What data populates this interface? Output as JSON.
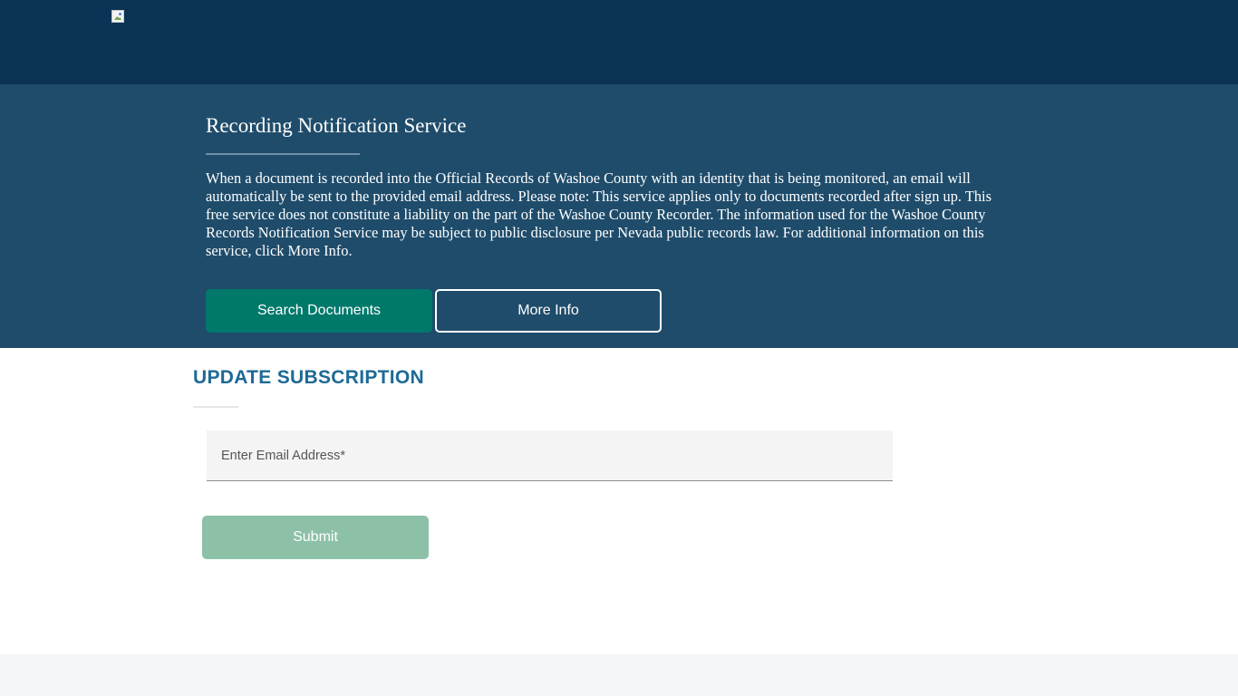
{
  "header": {
    "logo_icon": "broken-image-icon",
    "background": "#0b3355"
  },
  "hero": {
    "title": "Recording Notification Service",
    "description": "When a document is recorded into the Official Records of Washoe County with an identity that is being monitored, an email will automatically be sent to the provided email address. Please note: This service applies only to documents recorded after sign up. This free service does not constitute a liability on the part of the Washoe County Recorder. The information used for the Washoe County Records Notification Service may be subject to public disclosure per Nevada public records law. For additional information on this service, click More Info.",
    "search_button": "Search Documents",
    "more_info_button": "More Info",
    "background": "#1f4c6b"
  },
  "subscription": {
    "title": "UPDATE SUBSCRIPTION",
    "email_placeholder": "Enter Email Address*",
    "email_value": "",
    "submit_label": "Submit",
    "title_color": "#1d6a96",
    "submit_color": "#8cc1a8"
  }
}
